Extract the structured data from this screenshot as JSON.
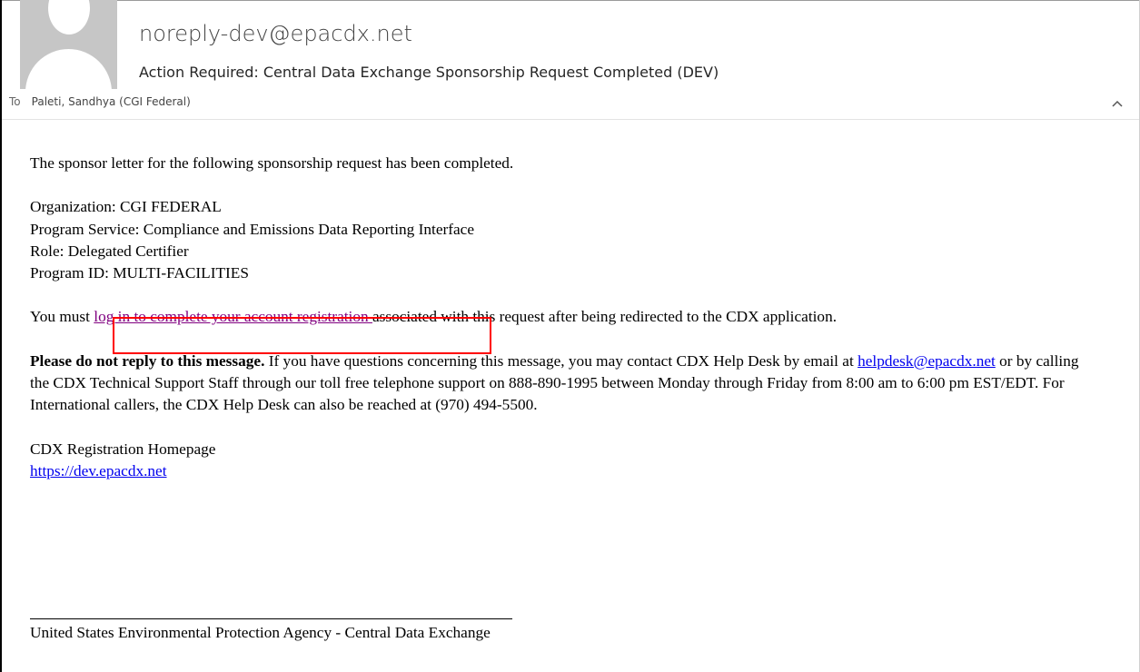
{
  "header": {
    "sender": "noreply-dev@epacdx.net",
    "subject": "Action Required: Central Data Exchange Sponsorship Request Completed (DEV)",
    "to_label": "To",
    "to_value": "Paleti, Sandhya (CGI Federal)"
  },
  "icons": {
    "avatar": "person-silhouette-icon",
    "collapse": "chevron-up-icon"
  },
  "body": {
    "intro": "The sponsor letter for the following sponsorship request has been completed.",
    "details": [
      "Organization: CGI FEDERAL",
      "Program Service: Compliance and Emissions Data Reporting Interface",
      "Role: Delegated Certifier",
      "Program ID: MULTI-FACILITIES"
    ],
    "must_prefix": "You must ",
    "login_link": "log in to complete your account registration ",
    "must_suffix": "associated with this request after being redirected to the CDX application.",
    "warning_bold": "Please do not reply to this message.",
    "warning_text_1": " If you have questions concerning this message, you may contact CDX Help Desk by email at ",
    "helpdesk_email": "helpdesk@epacdx.net",
    "warning_text_2": " or by calling the CDX Technical Support Staff through our toll free telephone support on 888-890-1995 between Monday through Friday from 8:00 am to 6:00 pm EST/EDT. For International callers, the CDX Help Desk can also be reached at (970) 494-5500.",
    "homepage_label": "CDX Registration Homepage",
    "homepage_url": "https://dev.epacdx.net"
  },
  "footer": {
    "text": "United States Environmental Protection Agency - Central Data Exchange"
  },
  "colors": {
    "visited_link": "#800080",
    "link": "#0000ee",
    "highlight": "#ff0000"
  }
}
